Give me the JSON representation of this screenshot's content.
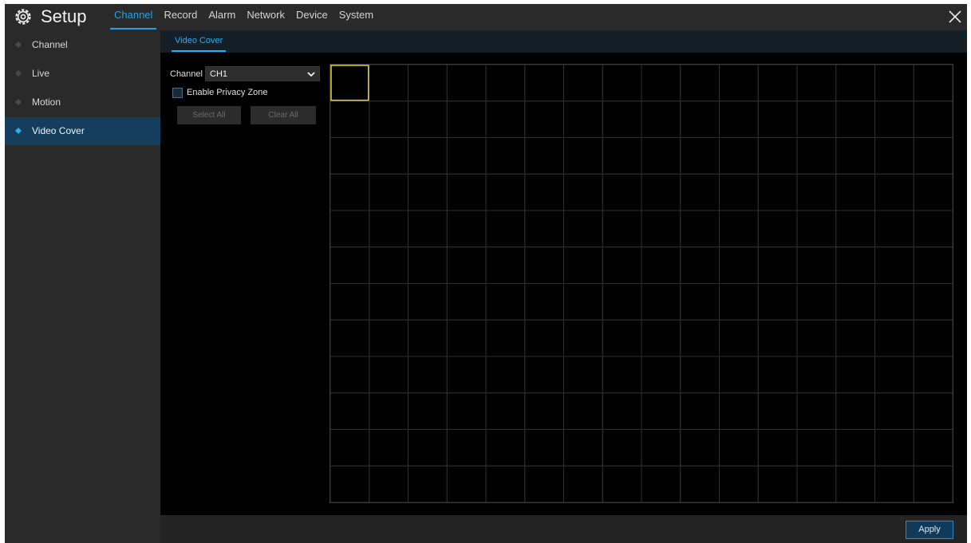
{
  "header": {
    "title": "Setup",
    "tabs": [
      {
        "label": "Channel",
        "active": true
      },
      {
        "label": "Record",
        "active": false
      },
      {
        "label": "Alarm",
        "active": false
      },
      {
        "label": "Network",
        "active": false
      },
      {
        "label": "Device",
        "active": false
      },
      {
        "label": "System",
        "active": false
      }
    ],
    "gear_icon": "gear-icon",
    "close_icon": "close-icon"
  },
  "sidebar": {
    "items": [
      {
        "label": "Channel",
        "active": false
      },
      {
        "label": "Live",
        "active": false
      },
      {
        "label": "Motion",
        "active": false
      },
      {
        "label": "Video Cover",
        "active": true
      }
    ]
  },
  "subtabs": [
    {
      "label": "Video Cover",
      "active": true
    }
  ],
  "controls": {
    "channel_label": "Channel",
    "channel_value": "CH1",
    "privacy_label": "Enable Privacy Zone",
    "privacy_checked": false,
    "select_all": "Select All",
    "clear_all": "Clear All"
  },
  "grid": {
    "columns": 16,
    "rows": 12,
    "selected_cells": [
      [
        0,
        0
      ]
    ]
  },
  "footer": {
    "apply": "Apply"
  },
  "colors": {
    "accent": "#1ea3e6",
    "selection": "#e6d21c",
    "sidebar_active": "#153e5c"
  }
}
